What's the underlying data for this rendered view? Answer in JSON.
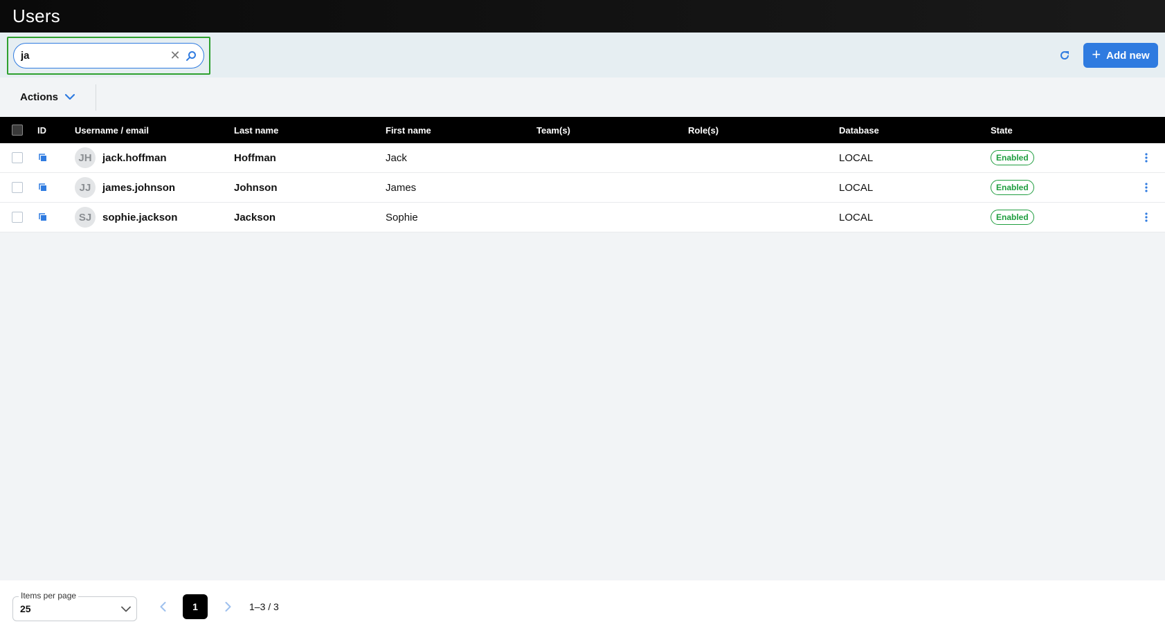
{
  "header": {
    "title": "Users"
  },
  "toolbar": {
    "search_value": "ja",
    "add_label": "Add new"
  },
  "actions": {
    "label": "Actions"
  },
  "table": {
    "columns": {
      "id": "ID",
      "username": "Username / email",
      "last_name": "Last name",
      "first_name": "First name",
      "teams": "Team(s)",
      "roles": "Role(s)",
      "database": "Database",
      "state": "State"
    },
    "rows": [
      {
        "initials": "JH",
        "username": "jack.hoffman",
        "last_name": "Hoffman",
        "first_name": "Jack",
        "teams": "",
        "roles": "",
        "database": "LOCAL",
        "state": "Enabled"
      },
      {
        "initials": "JJ",
        "username": "james.johnson",
        "last_name": "Johnson",
        "first_name": "James",
        "teams": "",
        "roles": "",
        "database": "LOCAL",
        "state": "Enabled"
      },
      {
        "initials": "SJ",
        "username": "sophie.jackson",
        "last_name": "Jackson",
        "first_name": "Sophie",
        "teams": "",
        "roles": "",
        "database": "LOCAL",
        "state": "Enabled"
      }
    ]
  },
  "footer": {
    "items_per_page_label": "Items per page",
    "items_per_page_value": "25",
    "current_page": "1",
    "range": "1–3 / 3"
  },
  "colors": {
    "accent": "#2f7be0",
    "enabled": "#1e9d3e",
    "focus_outline": "#2ea02e"
  },
  "icons": [
    "clear-icon",
    "search-icon",
    "refresh-icon",
    "plus-icon",
    "chevron-down-icon",
    "copy-icon",
    "kebab-menu-icon",
    "chevron-left-icon",
    "chevron-right-icon"
  ]
}
